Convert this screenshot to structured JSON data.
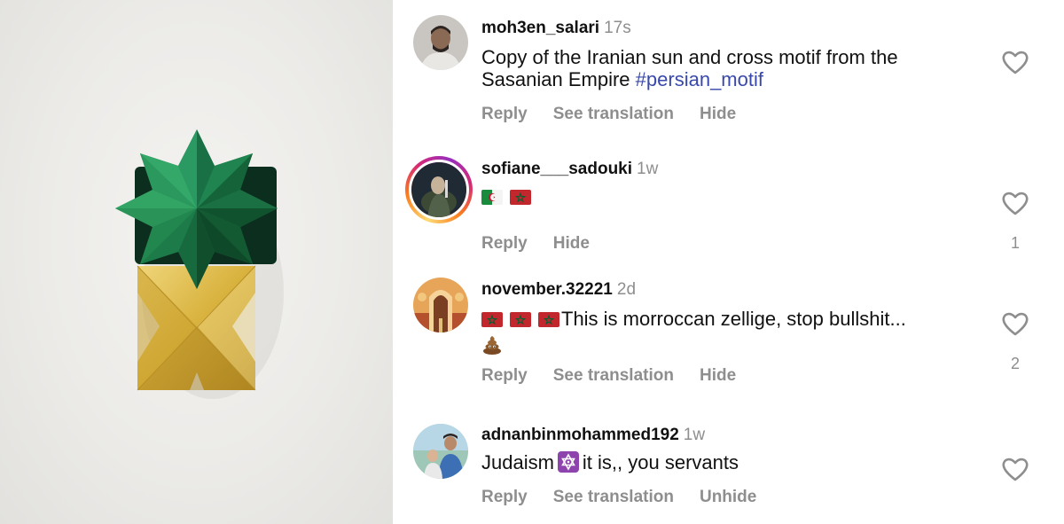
{
  "photo": {
    "icon": "green-star-gold-cross-motif"
  },
  "comments": [
    {
      "username": "moh3en_salari",
      "time": "17s",
      "text": "Copy of the Iranian sun and cross motif from the Sasanian Empire",
      "hashtag": "#persian_motif",
      "actions": {
        "reply": "Reply",
        "translate": "See translation",
        "hide": "Hide"
      },
      "likes": ""
    },
    {
      "username": "sofiane___sadouki",
      "time": "1w",
      "text": "",
      "flags": [
        "algeria-flag",
        "morocco-flag"
      ],
      "actions": {
        "reply": "Reply",
        "hide": "Hide"
      },
      "likes": "1"
    },
    {
      "username": "november.32221",
      "time": "2d",
      "text": "This is morroccan zellige, stop bullshit...",
      "flags": [
        "morocco-flag",
        "morocco-flag",
        "morocco-flag"
      ],
      "emoji": "pile-of-poo-emoji",
      "actions": {
        "reply": "Reply",
        "translate": "See translation",
        "hide": "Hide"
      },
      "likes": "2"
    },
    {
      "username": "adnanbinmohammed192",
      "time": "1w",
      "text_before": "Judaism",
      "text_after": "it is,, you servants",
      "emoji": "star-of-david-emoji",
      "actions": {
        "reply": "Reply",
        "translate": "See translation",
        "hide": "Unhide"
      },
      "likes": ""
    }
  ],
  "colors": {
    "hashtag": "#3949ab",
    "muted": "#8e8e8e",
    "star": "#1e7a4c",
    "cross": "#d9b63a"
  }
}
